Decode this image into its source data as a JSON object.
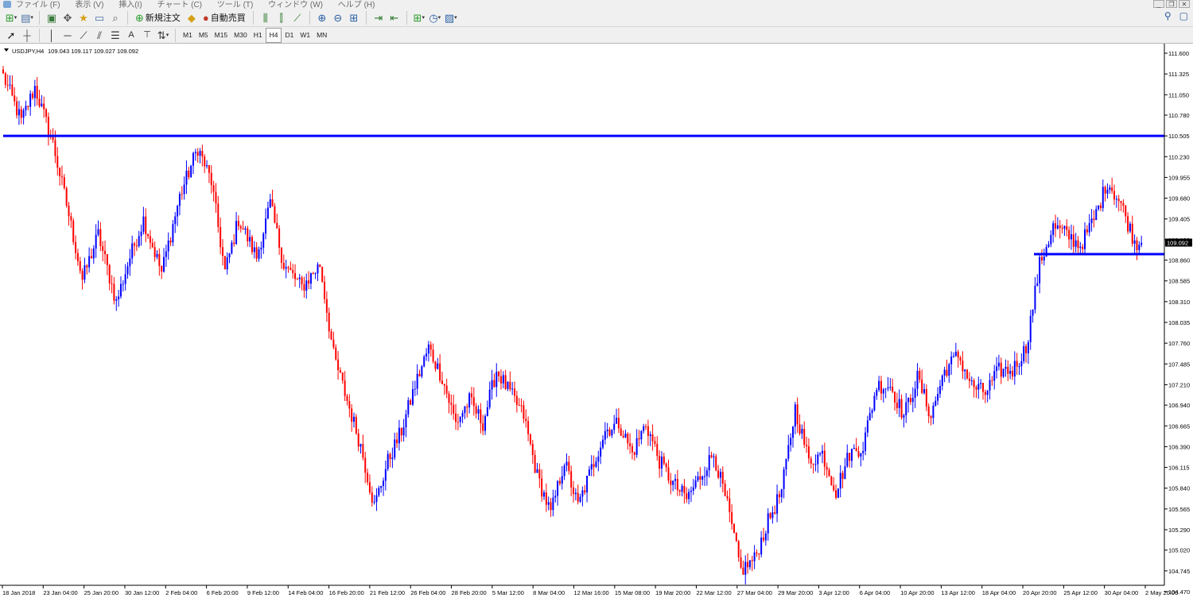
{
  "menu": [
    "ファイル (F)",
    "表示 (V)",
    "挿入(I)",
    "チャート (C)",
    "ツール (T)",
    "ウィンドウ (W)",
    "ヘルプ (H)"
  ],
  "toolbar1": {
    "new_order_label": "新規注文",
    "auto_trade_label": "自動売買"
  },
  "toolbar2": {
    "text_tool_label": "A",
    "timeframes": [
      "M1",
      "M5",
      "M15",
      "M30",
      "H1",
      "H4",
      "D1",
      "W1",
      "MN"
    ],
    "active_timeframe": "H4"
  },
  "chart_header": {
    "symbol": "USDJPY,H4",
    "ohlc": "109.043 109.117 109.027 109.092"
  },
  "colors": {
    "bull": "#0000ff",
    "bear": "#ff0000",
    "level_line": "#0000ff",
    "price_tag_bg": "#000000"
  },
  "chart_data": {
    "type": "candlestick",
    "symbol": "USDJPY",
    "timeframe": "H4",
    "current_price": "109.092",
    "y_ticks": [
      "111.600",
      "111.325",
      "111.050",
      "110.780",
      "110.505",
      "110.230",
      "109.955",
      "109.680",
      "109.405",
      "109.130",
      "108.860",
      "108.585",
      "108.310",
      "108.035",
      "107.760",
      "107.485",
      "107.210",
      "106.940",
      "106.665",
      "106.390",
      "106.115",
      "105.840",
      "105.565",
      "105.290",
      "105.020",
      "104.745",
      "104.470"
    ],
    "x_ticks": [
      "18 Jan 2018",
      "23 Jan 04:00",
      "25 Jan 20:00",
      "30 Jan 12:00",
      "2 Feb 04:00",
      "6 Feb 20:00",
      "9 Feb 12:00",
      "14 Feb 04:00",
      "16 Feb 20:00",
      "21 Feb 12:00",
      "26 Feb 04:00",
      "28 Feb 20:00",
      "5 Mar 12:00",
      "8 Mar 04:00",
      "12 Mar 16:00",
      "15 Mar 08:00",
      "19 Mar 20:00",
      "22 Mar 12:00",
      "27 Mar 04:00",
      "29 Mar 20:00",
      "3 Apr 12:00",
      "6 Apr 04:00",
      "10 Apr 20:00",
      "13 Apr 12:00",
      "18 Apr 04:00",
      "20 Apr 20:00",
      "25 Apr 12:00",
      "30 Apr 04:00",
      "2 May 20:00"
    ],
    "y_range": [
      104.47,
      111.6
    ],
    "horizontal_levels": [
      110.505,
      108.94
    ],
    "anchors": [
      [
        0,
        111.3
      ],
      [
        8,
        110.7
      ],
      [
        14,
        111.15
      ],
      [
        22,
        110.4
      ],
      [
        28,
        109.6
      ],
      [
        35,
        108.6
      ],
      [
        42,
        109.2
      ],
      [
        50,
        108.3
      ],
      [
        56,
        108.9
      ],
      [
        62,
        109.4
      ],
      [
        70,
        108.7
      ],
      [
        78,
        109.7
      ],
      [
        86,
        110.35
      ],
      [
        92,
        109.9
      ],
      [
        98,
        108.7
      ],
      [
        104,
        109.4
      ],
      [
        112,
        108.9
      ],
      [
        118,
        109.6
      ],
      [
        124,
        108.8
      ],
      [
        132,
        108.5
      ],
      [
        140,
        108.8
      ],
      [
        146,
        107.6
      ],
      [
        152,
        107.0
      ],
      [
        158,
        106.4
      ],
      [
        164,
        105.6
      ],
      [
        170,
        106.2
      ],
      [
        176,
        106.6
      ],
      [
        182,
        107.2
      ],
      [
        188,
        107.7
      ],
      [
        194,
        107.3
      ],
      [
        200,
        106.7
      ],
      [
        206,
        107.0
      ],
      [
        212,
        106.7
      ],
      [
        218,
        107.4
      ],
      [
        224,
        107.1
      ],
      [
        230,
        106.8
      ],
      [
        236,
        106.0
      ],
      [
        242,
        105.5
      ],
      [
        248,
        106.2
      ],
      [
        254,
        105.6
      ],
      [
        260,
        106.1
      ],
      [
        266,
        106.6
      ],
      [
        272,
        106.7
      ],
      [
        278,
        106.3
      ],
      [
        284,
        106.7
      ],
      [
        290,
        106.2
      ],
      [
        296,
        105.9
      ],
      [
        302,
        105.7
      ],
      [
        308,
        106.0
      ],
      [
        314,
        106.3
      ],
      [
        320,
        105.6
      ],
      [
        326,
        104.75
      ],
      [
        332,
        104.9
      ],
      [
        338,
        105.4
      ],
      [
        344,
        105.8
      ],
      [
        350,
        106.9
      ],
      [
        356,
        106.2
      ],
      [
        362,
        106.3
      ],
      [
        368,
        105.8
      ],
      [
        374,
        106.3
      ],
      [
        380,
        106.4
      ],
      [
        386,
        107.2
      ],
      [
        392,
        107.2
      ],
      [
        398,
        106.8
      ],
      [
        404,
        107.3
      ],
      [
        410,
        106.8
      ],
      [
        416,
        107.4
      ],
      [
        422,
        107.6
      ],
      [
        428,
        107.2
      ],
      [
        434,
        107.1
      ],
      [
        440,
        107.4
      ],
      [
        446,
        107.4
      ],
      [
        452,
        107.7
      ],
      [
        458,
        108.8
      ],
      [
        464,
        109.3
      ],
      [
        470,
        109.2
      ],
      [
        476,
        109.05
      ],
      [
        482,
        109.4
      ],
      [
        488,
        109.9
      ],
      [
        494,
        109.6
      ],
      [
        500,
        109.1
      ],
      [
        503,
        109.09
      ]
    ]
  }
}
